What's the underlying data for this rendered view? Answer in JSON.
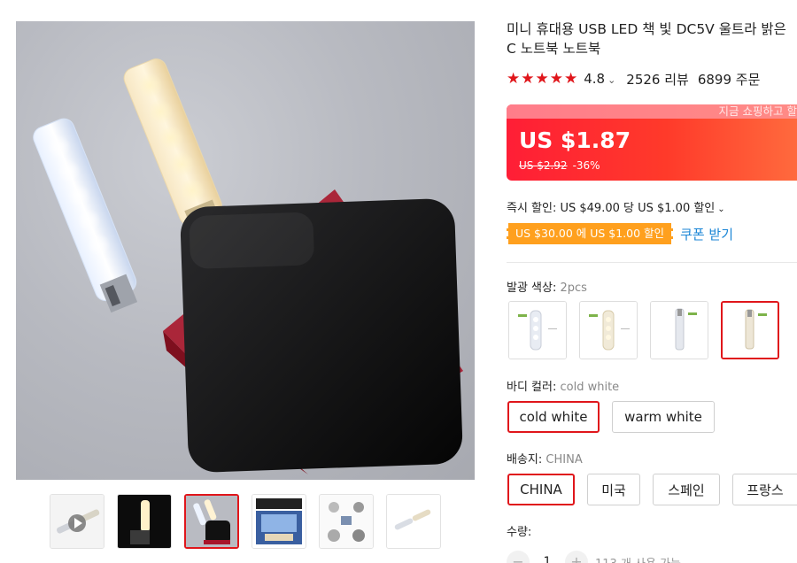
{
  "product": {
    "title": "미니 휴대용 USB LED 책 빛 DC5V 울트라 밝은 C 노트북 노트북",
    "rating": "4.8",
    "reviews": "2526 리뷰",
    "orders": "6899 주문",
    "stars": "★★★★★"
  },
  "price": {
    "banner_text": "지금 쇼핑하고 할",
    "current": "US $1.87",
    "original": "US $2.92",
    "discount": "-36%"
  },
  "promo": {
    "instant_discount": "즉시 할인: US $49.00 당 US $1.00 할인",
    "coupon_badge": "US $30.00 에 US $1.00 할인",
    "coupon_link": "쿠폰 받기"
  },
  "options": {
    "emit_color_label": "발광 색상:",
    "emit_color_value": "2pcs",
    "body_color_label": "바디 컬러:",
    "body_color_value": "cold white",
    "body_colors": [
      "cold white",
      "warm white"
    ],
    "ship_from_label": "배송지:",
    "ship_from_value": "CHINA",
    "ship_from": [
      "CHINA",
      "미국",
      "스페인",
      "프랑스"
    ],
    "quantity_label": "수량:",
    "quantity_value": "1",
    "quantity_note": "113 개 사용 가능"
  },
  "colors": {
    "accent": "#e0161b",
    "coupon": "#ffa01e",
    "link": "#1b86d6"
  }
}
